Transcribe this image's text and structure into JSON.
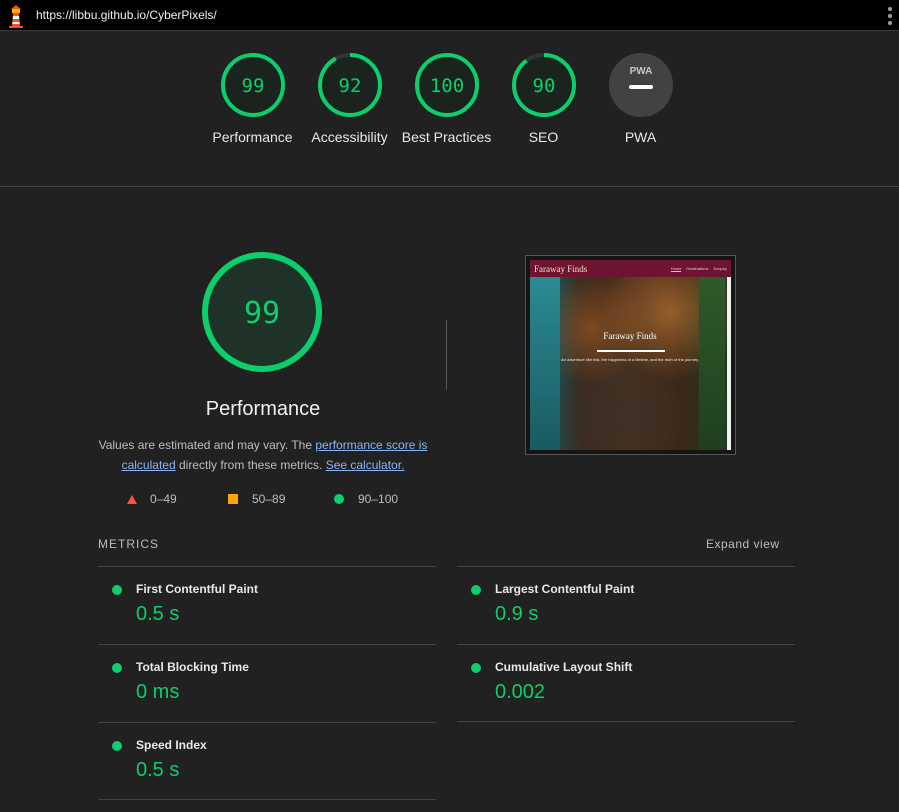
{
  "topbar": {
    "url": "https://libbu.github.io/CyberPixels/"
  },
  "gauges": [
    {
      "score": "99",
      "label": "Performance"
    },
    {
      "score": "92",
      "label": "Accessibility"
    },
    {
      "score": "100",
      "label": "Best Practices"
    },
    {
      "score": "90",
      "label": "SEO"
    },
    {
      "score": "",
      "label": "PWA",
      "badge": "PWA"
    }
  ],
  "performance": {
    "score": "99",
    "title": "Performance",
    "desc_prefix": "Values are estimated and may vary. The ",
    "link1": "performance score is calculated",
    "desc_middle": " directly from these metrics. ",
    "link2": "See calculator."
  },
  "legend": [
    {
      "range": "0–49",
      "shape": "triangle",
      "color": "#ff4e42"
    },
    {
      "range": "50–89",
      "shape": "square",
      "color": "#ffa400"
    },
    {
      "range": "90–100",
      "shape": "circle",
      "color": "#0cce6b"
    }
  ],
  "screenshot": {
    "brand": "Faraway Finds",
    "nav": [
      "Home",
      "Destinations",
      "Enquiry"
    ],
    "heading": "Faraway Finds",
    "subtitle": "An adventure like this, the happiness of a lifetime, and the truth of the journey."
  },
  "metrics": {
    "heading": "METRICS",
    "expand": "Expand view",
    "items": [
      {
        "title": "First Contentful Paint",
        "value": "0.5 s"
      },
      {
        "title": "Largest Contentful Paint",
        "value": "0.9 s"
      },
      {
        "title": "Total Blocking Time",
        "value": "0 ms"
      },
      {
        "title": "Cumulative Layout Shift",
        "value": "0.002"
      },
      {
        "title": "Speed Index",
        "value": "0.5 s"
      }
    ]
  },
  "colors": {
    "pass": "#0cce6b",
    "average": "#ffa400",
    "fail": "#ff4e42",
    "background": "#212121"
  }
}
